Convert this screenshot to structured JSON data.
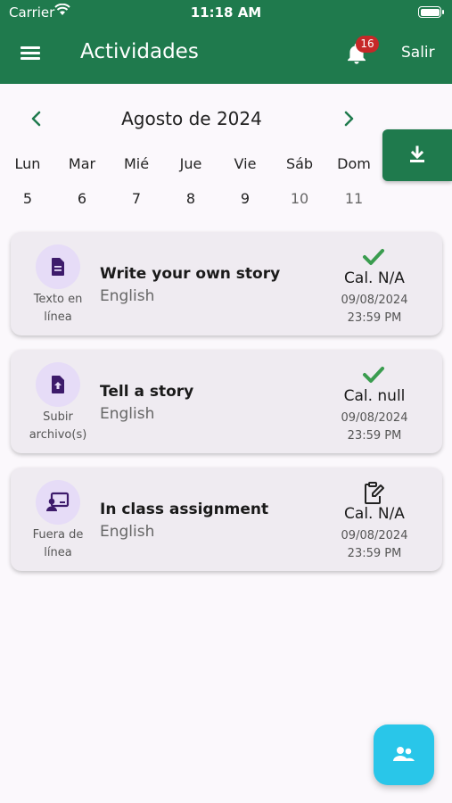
{
  "status_bar": {
    "carrier": "Carrier",
    "time": "11:18 AM"
  },
  "header": {
    "title": "Actividades",
    "notifications_count": "16",
    "logout_label": "Salir"
  },
  "calendar": {
    "month_label": "Agosto de 2024",
    "weekdays": [
      "Lun",
      "Mar",
      "Mié",
      "Jue",
      "Vie",
      "Sáb",
      "Dom"
    ],
    "dates": [
      "5",
      "6",
      "7",
      "8",
      "9",
      "10",
      "11"
    ]
  },
  "activities": [
    {
      "type_icon": "document-icon",
      "type_label_1": "Texto en",
      "type_label_2": "línea",
      "title": "Write your own story",
      "subject": "English",
      "status_icon": "check-icon",
      "grade": "Cal. N/A",
      "due_date": "09/08/2024",
      "due_time": "23:59 PM"
    },
    {
      "type_icon": "upload-file-icon",
      "type_label_1": "Subir",
      "type_label_2": "archivo(s)",
      "title": "Tell a story",
      "subject": "English",
      "status_icon": "check-icon",
      "grade": "Cal. null",
      "due_date": "09/08/2024",
      "due_time": "23:59 PM"
    },
    {
      "type_icon": "presentation-icon",
      "type_label_1": "Fuera de",
      "type_label_2": "línea",
      "title": "In class assignment",
      "subject": "English",
      "status_icon": "clipboard-edit-icon",
      "grade": "Cal. N/A",
      "due_date": "09/08/2024",
      "due_time": "23:59 PM"
    }
  ],
  "colors": {
    "primary": "#1f7a4d",
    "check": "#3a9c4f",
    "fab": "#29c6e9",
    "icon_purple": "#3d1b6b",
    "badge": "#c62828"
  }
}
